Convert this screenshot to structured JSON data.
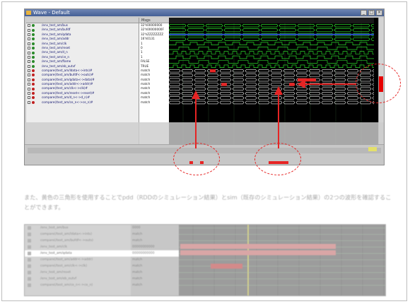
{
  "window": {
    "title": "Wave - Default",
    "header_messages": "Msgs"
  },
  "signals": [
    {
      "name": "/env_test_am/bus",
      "value": "32'h00000000",
      "dot": "#2a8a2a"
    },
    {
      "name": "/env_test_am/bufdf",
      "value": "32'h00000000F",
      "dot": "#2a8a2a"
    },
    {
      "name": "/env_test_am/qdata",
      "value": "32'hZZZZZZZZ",
      "dot": "#2a8a2a"
    },
    {
      "name": "/env_test_am/addr",
      "value": "16'h0131",
      "dot": "#2a8a2a"
    },
    {
      "name": "/env_test_am/clk",
      "value": "1",
      "dot": "#2a8a2a"
    },
    {
      "name": "/env_test_am/reset",
      "value": "0",
      "dot": "#2a8a2a"
    },
    {
      "name": "/env_test_am/d_n",
      "value": "1",
      "dot": "#2a8a2a"
    },
    {
      "name": "/env_test_am/ce_n",
      "value": "1",
      "dot": "#2a8a2a"
    },
    {
      "name": "/env_test_am/flame",
      "value": "FALSE",
      "dot": "#2a8a2a"
    },
    {
      "name": "/env_test_am/eb_outvf",
      "value": "TRUE",
      "dot": "#2a8a2a"
    },
    {
      "name": "compare(/test_am/ldata<->ints)#",
      "value": "match",
      "dot": "#c02020"
    },
    {
      "name": "compare(/test_am/bufdf<->outs)#",
      "value": "match",
      "dot": "#c02020"
    },
    {
      "name": "compare(/test_am/qdata<->data)#",
      "value": "match",
      "dot": "#c02020"
    },
    {
      "name": "compare(/test_am/addr<->addr)#",
      "value": "match",
      "dot": "#c02020"
    },
    {
      "name": "compare(/test_am/clk<->clk)#",
      "value": "match",
      "dot": "#c02020"
    },
    {
      "name": "compare(/test_am/reset<->reset)#",
      "value": "match",
      "dot": "#c02020"
    },
    {
      "name": "compare(/test_am/d_n<->d_n)#",
      "value": "match",
      "dot": "#c02020"
    },
    {
      "name": "compare(/test_am/ce_n<->ce_n)#",
      "value": "match",
      "dot": "#c02020"
    }
  ],
  "second_shot": {
    "rows": [
      {
        "name": "/env_test_am/bus",
        "value": "0000"
      },
      {
        "name": "compare(/test_am/ldata<->ints)",
        "value": "match"
      },
      {
        "name": "compare(/test_am/bufdf<->outs)",
        "value": "match"
      },
      {
        "name": "/env_test_am/clk",
        "value": "00000000000"
      },
      {
        "name": "/env_test_am/qdata",
        "value": "00000000000"
      },
      {
        "name": "compare(/test_am/addr<->addr)",
        "value": "match"
      },
      {
        "name": "compare(/test_am/clk<->clk)",
        "value": "match"
      },
      {
        "name": "/env_test_am/reset",
        "value": "match"
      },
      {
        "name": "/env_test_am/eb_outvf",
        "value": "match"
      },
      {
        "name": "compare(/test_am/ce_n<->ce_n)",
        "value": "match"
      }
    ]
  },
  "paragraph": "また、黄色の三角形を使用することでpdd（RDDのシミュレーション結果）とsim（既存のシミュレーション結果）の2つの波形を確認することができます。",
  "colors": {
    "highlight_red": "#e62424",
    "wave_green": "#33ff33",
    "wave_bg": "#000000"
  }
}
